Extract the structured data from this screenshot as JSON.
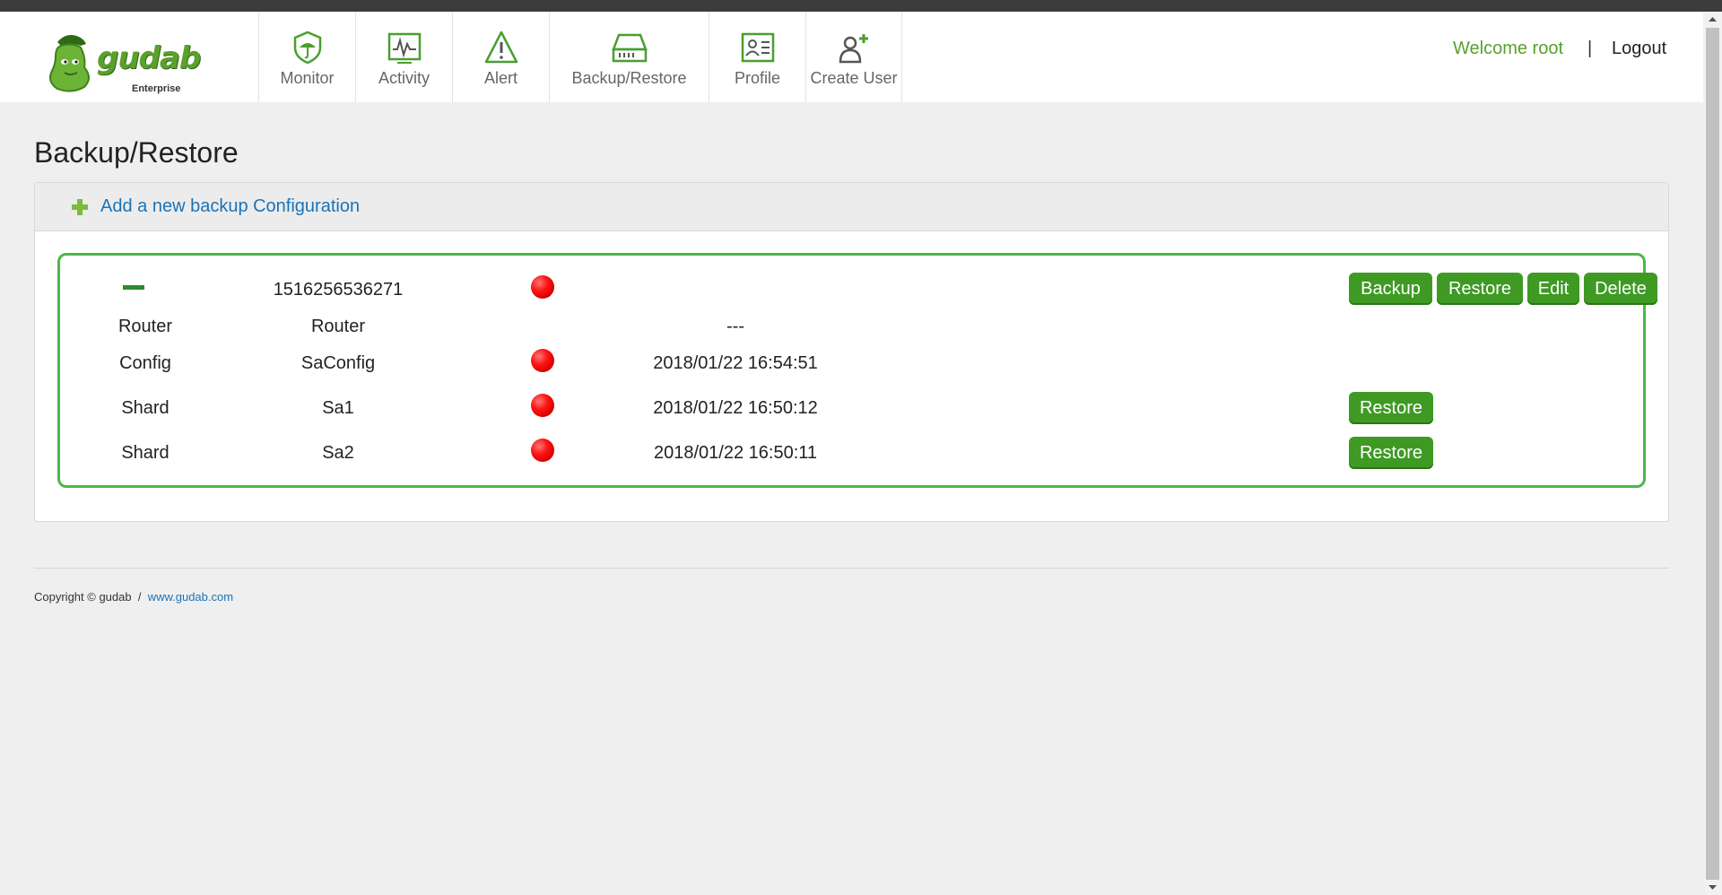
{
  "header": {
    "logo_text": "gudab",
    "logo_sub": "Enterprise",
    "nav": [
      {
        "label": "Monitor",
        "icon": "monitor-shield-icon"
      },
      {
        "label": "Activity",
        "icon": "activity-graph-icon"
      },
      {
        "label": "Alert",
        "icon": "alert-triangle-icon"
      },
      {
        "label": "Backup/Restore",
        "icon": "drive-icon"
      },
      {
        "label": "Profile",
        "icon": "profile-card-icon"
      },
      {
        "label": "Create User",
        "icon": "add-user-icon"
      }
    ],
    "welcome": "Welcome root",
    "separator": "|",
    "logout": "Logout"
  },
  "page": {
    "title": "Backup/Restore",
    "add_link": "Add a new backup Configuration"
  },
  "backup_config": {
    "id": "1516256536271",
    "actions": [
      "Backup",
      "Restore",
      "Edit",
      "Delete"
    ],
    "rows": [
      {
        "type": "Router",
        "name": "Router",
        "status": "",
        "time": "---",
        "restore": ""
      },
      {
        "type": "Config",
        "name": "SaConfig",
        "status": "red",
        "time": "2018/01/22 16:54:51",
        "restore": ""
      },
      {
        "type": "Shard",
        "name": "Sa1",
        "status": "red",
        "time": "2018/01/22 16:50:12",
        "restore": "Restore"
      },
      {
        "type": "Shard",
        "name": "Sa2",
        "status": "red",
        "time": "2018/01/22 16:50:11",
        "restore": "Restore"
      }
    ]
  },
  "footer": {
    "copyright": "Copyright © gudab",
    "divider": "/",
    "site": "www.gudab.com"
  },
  "colors": {
    "brand_green": "#5aa02c",
    "button_green": "#3f9a24",
    "box_border": "#4cb848",
    "link_blue": "#1a73b8",
    "status_red": "#ff1414"
  }
}
